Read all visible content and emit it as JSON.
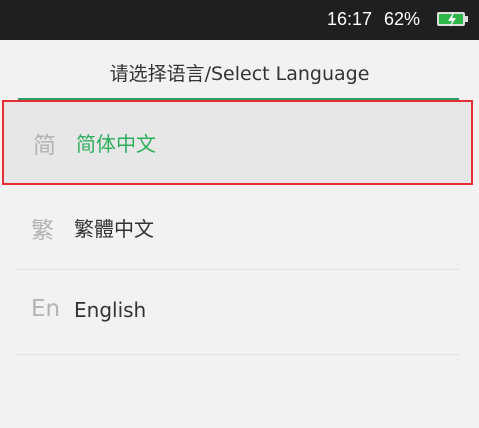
{
  "status_bar": {
    "time": "16:17",
    "battery_percent": "62%",
    "battery_icon": "battery-charging-icon",
    "battery_color": "#2fb64a"
  },
  "header": {
    "title": "请选择语言/Select Language",
    "divider_color": "#2e9c67"
  },
  "languages": [
    {
      "icon_text": "简",
      "label": "简体中文",
      "selected": true
    },
    {
      "icon_text": "繁",
      "label": "繁體中文",
      "selected": false
    },
    {
      "icon_text": "En",
      "label": "English",
      "selected": false
    }
  ],
  "colors": {
    "selected_text": "#2fae5e",
    "selection_outline": "#e52d33"
  }
}
